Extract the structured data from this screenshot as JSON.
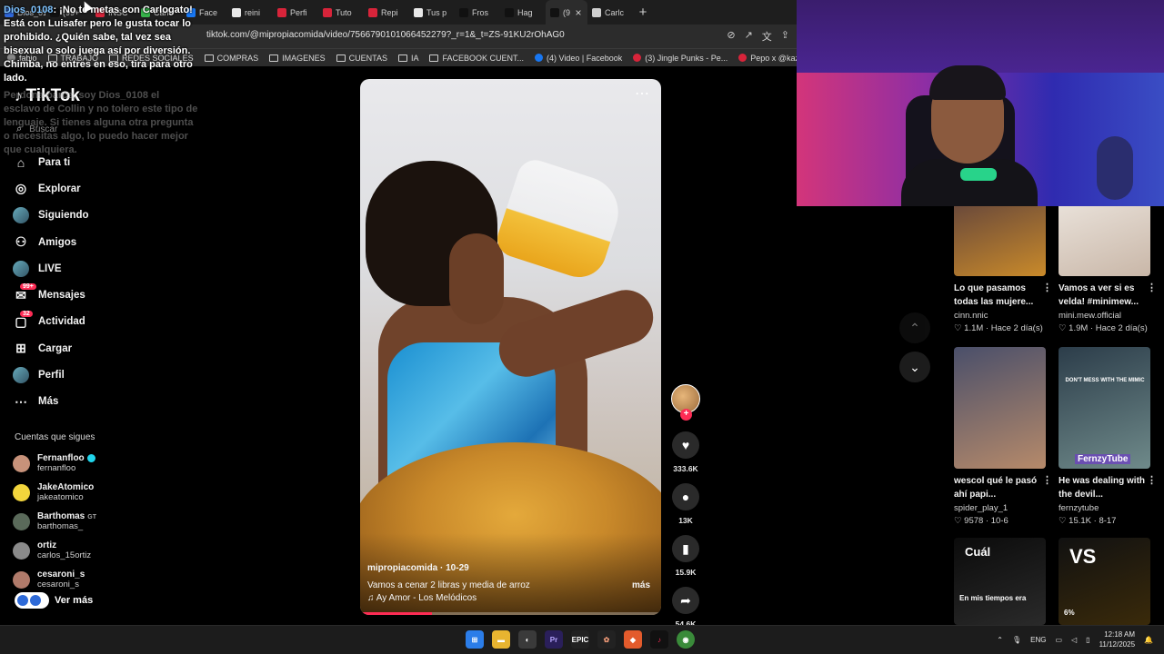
{
  "browser": {
    "tabs": [
      {
        "label": "Dios_0108",
        "color": "#2f67d8"
      },
      {
        "label": "(99+",
        "color": "#111111"
      },
      {
        "label": "INSC",
        "color": "#d8243a"
      },
      {
        "label": "Carlc",
        "color": "#36b24a"
      },
      {
        "label": "Face",
        "color": "#1877f2"
      },
      {
        "label": "reini",
        "color": "#e9e9e9"
      },
      {
        "label": "Perfi",
        "color": "#d8243a"
      },
      {
        "label": "Tuto",
        "color": "#d8243a"
      },
      {
        "label": "Repi",
        "color": "#d8243a"
      },
      {
        "label": "Tus p",
        "color": "#e9e9e9"
      },
      {
        "label": "Fros",
        "color": "#111111"
      },
      {
        "label": "Hag",
        "color": "#111111"
      },
      {
        "label": "(9",
        "color": "#111111"
      },
      {
        "label": "Carlc",
        "color": "#cfcfcf"
      }
    ],
    "url": "tiktok.com/@mipropiacomida/video/7566790101066452279?_r=1&_t=ZS-91KU2rOhAG0",
    "bookmarks": [
      {
        "label": "fabio",
        "type": "site"
      },
      {
        "label": "TRABAJO",
        "type": "folder"
      },
      {
        "label": "REDES SOCIALES",
        "type": "folder"
      },
      {
        "label": "COMPRAS",
        "type": "folder"
      },
      {
        "label": "IMAGENES",
        "type": "folder"
      },
      {
        "label": "CUENTAS",
        "type": "folder"
      },
      {
        "label": "IA",
        "type": "folder"
      },
      {
        "label": "FACEBOOK CUENT...",
        "type": "folder"
      },
      {
        "label": "(4) Video | Facebook",
        "type": "site",
        "color": "#1877f2"
      },
      {
        "label": "(3) Jingle Punks - Pe...",
        "type": "site",
        "color": "#d8243a"
      },
      {
        "label": "Pepo x @kazu.oficia...",
        "type": "site",
        "color": "#d8243a"
      }
    ]
  },
  "chat": {
    "user1": "Dios_0108",
    "message1": ": ¡No te metas con Carlogato! Está con Luisafer pero le gusta tocar lo prohibido. ¿Quién sabe, tal vez sea bisexual o solo juega así por diversión. Chimba, no entres en eso, tira para otro lado.",
    "message2": "Perdona parce, soy Dios_0108 el esclavo de Collin y no tolero este tipo de lenguaje. Si tienes alguna otra pregunta o necesitas algo, lo puedo hacer mejor que cualquiera."
  },
  "sidebar": {
    "logo": "TikTok",
    "search_placeholder": "Buscar",
    "nav": [
      {
        "label": "Para ti",
        "icon": "home-icon",
        "glyph": "⌂"
      },
      {
        "label": "Explorar",
        "icon": "compass-icon",
        "glyph": "◎"
      },
      {
        "label": "Siguiendo",
        "icon": "avatar",
        "glyph": ""
      },
      {
        "label": "Amigos",
        "icon": "friends-icon",
        "glyph": "⚇"
      },
      {
        "label": "LIVE",
        "icon": "live-avatar",
        "glyph": ""
      },
      {
        "label": "Mensajes",
        "icon": "messages-icon",
        "glyph": "✉",
        "badge": "99+"
      },
      {
        "label": "Actividad",
        "icon": "activity-icon",
        "glyph": "▢",
        "badge": "32"
      },
      {
        "label": "Cargar",
        "icon": "upload-icon",
        "glyph": "⊞"
      },
      {
        "label": "Perfil",
        "icon": "profile-avatar",
        "glyph": ""
      },
      {
        "label": "Más",
        "icon": "more-icon",
        "glyph": "⋯"
      }
    ],
    "following_title": "Cuentas que sigues",
    "following": [
      {
        "name": "Fernanfloo",
        "handle": "fernanfloo",
        "verified": true,
        "color": "#c7927a"
      },
      {
        "name": "JakeAtomico",
        "handle": "jakeatomico",
        "color": "#f2d53c"
      },
      {
        "name": "Barthomas",
        "handle": "barthomas_",
        "tag": "GT",
        "color": "#5a6a5a"
      },
      {
        "name": "ortiz",
        "handle": "carlos_15ortiz",
        "color": "#8a8a8a"
      },
      {
        "name": "cesaroni_s",
        "handle": "cesaroni_s",
        "color": "#b07a6a"
      }
    ],
    "see_more": "Ver más"
  },
  "video": {
    "author": "mipropiacomida · 10-29",
    "caption": "Vamos a cenar 2 libras y media de arroz",
    "more": "más",
    "music": "♫ Ay Amor - Los Melódicos",
    "progress_percent": 24,
    "likes": "333.6K",
    "comments": "13K",
    "saves": "15.9K",
    "shares": "54.6K"
  },
  "feed": [
    {
      "title": "Lo que pasamos todas las mujere...",
      "user": "cinn.nnic",
      "likes": "1.1M",
      "date": "Hace 2 día(s)",
      "colors": [
        "#6b4a3a",
        "#c98a2a"
      ]
    },
    {
      "title": "Vamos a ver si es velda! #minimew...",
      "user": "mini.mew.official",
      "likes": "1.9M",
      "date": "Hace 2 día(s)",
      "colors": [
        "#e8e0d8",
        "#c9b7a8"
      ]
    },
    {
      "title": "wescol qué le pasó ahí papi...",
      "user": "spider_play_1",
      "likes": "9578",
      "date": "10-6",
      "colors": [
        "#4a4f6a",
        "#b68a6a"
      ]
    },
    {
      "title": "He was dealing with the devil...",
      "user": "fernzytube",
      "likes": "15.1K",
      "date": "8-17",
      "label": "FernzyTube",
      "overlay": "DON'T MESS WITH THE MIMIC",
      "colors": [
        "#2c3d4a",
        "#6f8a8a"
      ]
    },
    {
      "overlay1": "Cuál",
      "overlay2": "En mis tiempos era",
      "colors": [
        "#0b0b0b",
        "#2a2a2a"
      ]
    },
    {
      "overlay1": "VS",
      "overlay2": "6%",
      "colors": [
        "#111111",
        "#3a2a0a"
      ]
    }
  ],
  "taskbar": {
    "language": "ENG",
    "time": "12:18 AM",
    "date": "11/12/2025"
  }
}
